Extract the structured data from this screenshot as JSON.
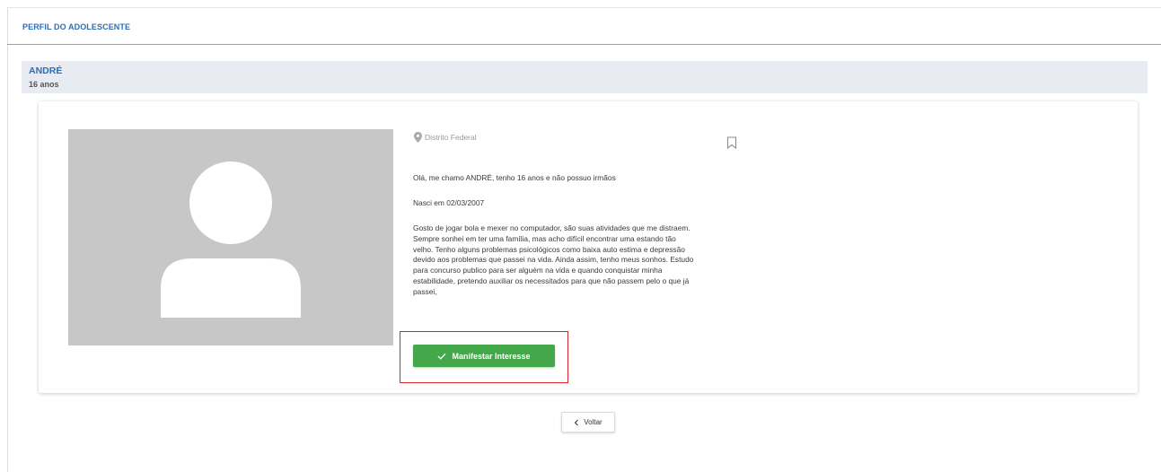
{
  "header": {
    "title": "PERFIL DO ADOLESCENTE"
  },
  "profile": {
    "name": "ANDRÉ",
    "age": "16 anos",
    "location": "Distrito Federal",
    "intro": "Olá, me chamo ANDRÉ, tenho 16 anos e não possuo irmãos",
    "birth": "Nasci em 02/03/2007",
    "story_lines": [
      "Gosto de jogar bola e mexer no computador, são suas atividades que me distraem.",
      "Sempre sonhei em ter uma família, mas acho difícil encontrar uma estando tão",
      "velho. Tenho alguns problemas psicológicos como baixa auto estima e depressão",
      "devido aos problemas que passei na vida. Ainda assim, tenho meus sonhos. Estudo",
      "para concurso publico para ser alguém na vida e quando conquistar minha",
      "estabilidade, pretendo auxiliar os necessitados para que não passem pelo o que já",
      "passei,"
    ]
  },
  "actions": {
    "interest_label": "Manifestar Interesse",
    "back_label": "Voltar"
  },
  "icons": {
    "location": "map-pin-icon",
    "bookmark": "bookmark-icon",
    "zoom": "zoom-in-icon",
    "check": "check-icon",
    "back": "chevron-left-icon"
  },
  "colors": {
    "accent": "#2c6db5",
    "button_green": "#44a84a",
    "highlight_red": "#d8232a",
    "band": "#e8ecf2",
    "photo_bg": "#c7c7c7"
  }
}
